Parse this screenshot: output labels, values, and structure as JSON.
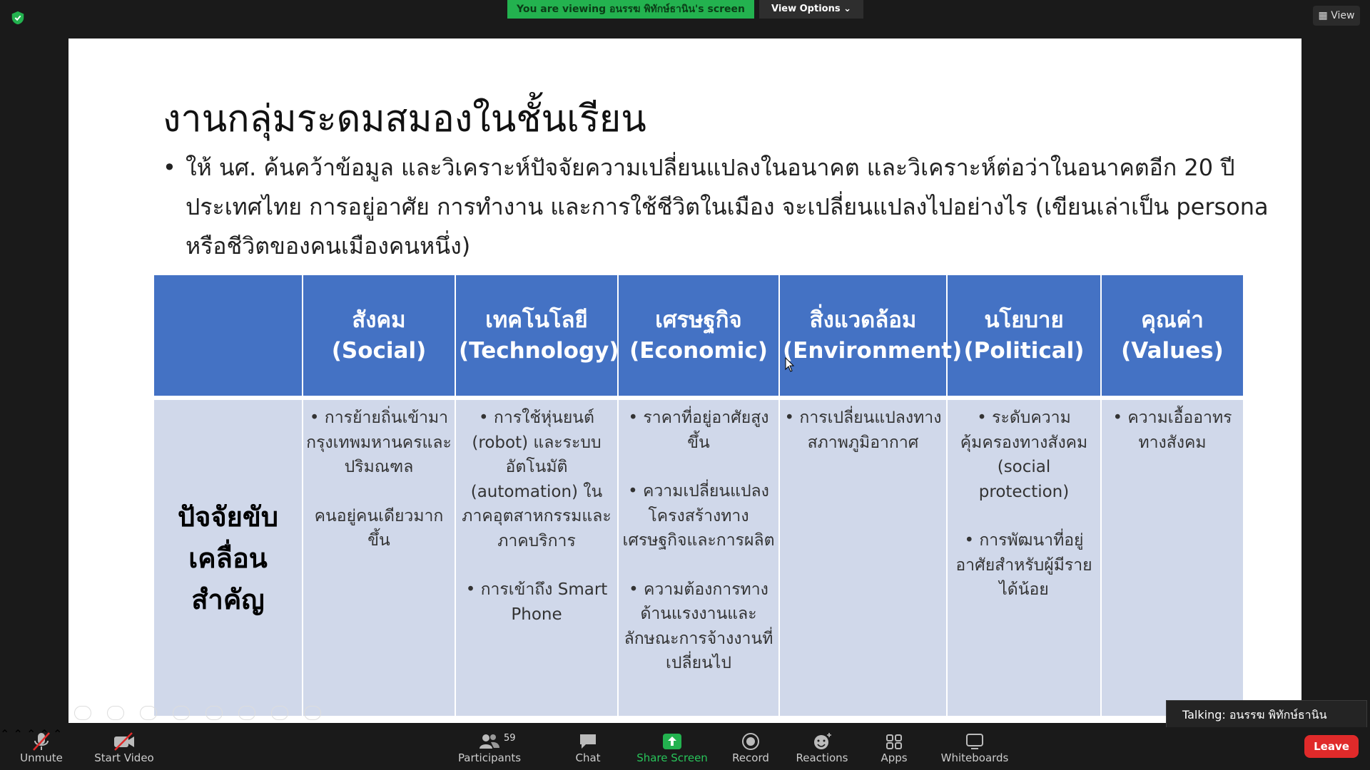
{
  "window": {
    "viewing_banner": "You are viewing อนรรฆ พิทักษ์ธานิน's screen",
    "view_options_label": "View Options ⌄",
    "view_button_label": "View"
  },
  "slide": {
    "title": "งานกลุ่มระดมสมองในชั้นเรียน",
    "bullet": "ให้ นศ. ค้นคว้าข้อมูล และวิเคราะห์ปัจจัยความเปลี่ยนแปลงในอนาคต และวิเคราะห์ต่อว่าในอนาคตอีก 20 ปี ประเทศไทย การอยู่อาศัย การทำงาน และการใช้ชีวิตในเมือง จะเปลี่ยนแปลงไปอย่างไร (เขียนเล่าเป็น persona หรือชีวิตของคนเมืองคนหนึ่ง)",
    "table": {
      "row_header": "ปัจจัยขับเคลื่อนสำคัญ",
      "columns": [
        {
          "th": "สังคม",
          "en": "(Social)"
        },
        {
          "th": "เทคโนโลยี",
          "en": "(Technology)"
        },
        {
          "th": "เศรษฐกิจ",
          "en": "(Economic)"
        },
        {
          "th": "สิ่งแวดล้อม",
          "en": "(Environment)"
        },
        {
          "th": "นโยบาย",
          "en": "(Political)"
        },
        {
          "th": "คุณค่า",
          "en": "(Values)"
        }
      ],
      "cells": [
        [
          "• การย้ายถิ่นเข้ามากรุงเทพมหานครและปริมณฑล",
          "คนอยู่คนเดียวมากขึ้น"
        ],
        [
          "• การใช้หุ่นยนต์ (robot) และระบบอัตโนมัติ (automation) ในภาคอุตสาหกรรมและภาคบริการ",
          "• การเข้าถึง Smart Phone"
        ],
        [
          "• ราคาที่อยู่อาศัยสูงขึ้น",
          "• ความเปลี่ยนแปลงโครงสร้างทางเศรษฐกิจและการผลิต",
          "• ความต้องการทางด้านแรงงานและลักษณะการจ้างงานที่เปลี่ยนไป"
        ],
        [
          "• การเปลี่ยนแปลงทางสภาพภูมิอากาศ"
        ],
        [
          "• ระดับความคุ้มครองทางสังคม (social protection)",
          "• การพัฒนาที่อยู่อาศัยสำหรับผู้มีรายได้น้อย"
        ],
        [
          "• ความเอื้ออาทรทางสังคม"
        ]
      ]
    }
  },
  "toast": {
    "talking": "Talking: อนรรฆ พิทักษ์ธานิน"
  },
  "toolbar": {
    "unmute": "Unmute",
    "start_video": "Start Video",
    "participants": "Participants",
    "participants_count": "59",
    "chat": "Chat",
    "share_screen": "Share Screen",
    "record": "Record",
    "reactions": "Reactions",
    "apps": "Apps",
    "whiteboards": "Whiteboards",
    "leave": "Leave"
  },
  "colors": {
    "accent": "#23b24f",
    "table_header": "#4472c4",
    "table_body": "#d0d8ea",
    "leave": "#e02a2a"
  }
}
